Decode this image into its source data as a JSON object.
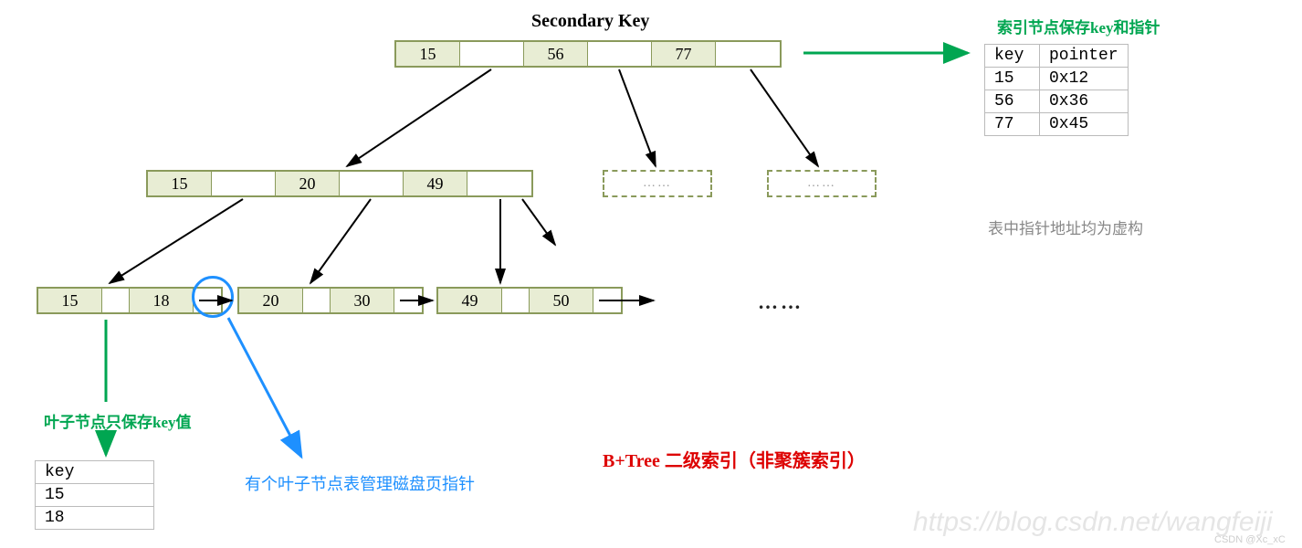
{
  "title": "Secondary Key",
  "green_label_top": "索引节点保存key和指针",
  "green_label_leaf": "叶子节点只保存key值",
  "blue_label": "有个叶子节点表管理磁盘页指针",
  "red_label": "B+Tree 二级索引（非聚簇索引）",
  "gray_label": "表中指针地址均为虚构",
  "watermark": "https://blog.csdn.net/wangfeiji",
  "attribution": "CSDN @Xc_xC",
  "root_node": {
    "c1": "15",
    "c2": "56",
    "c3": "77"
  },
  "child_node": {
    "c1": "15",
    "c2": "20",
    "c3": "49"
  },
  "leaf1": {
    "c1": "15",
    "c2": "18"
  },
  "leaf2": {
    "c1": "20",
    "c2": "30"
  },
  "leaf3": {
    "c1": "49",
    "c2": "50"
  },
  "ellipsis": "……",
  "pointer_table": {
    "header": {
      "c1": "key",
      "c2": "pointer"
    },
    "r1": {
      "c1": "15",
      "c2": "0x12"
    },
    "r2": {
      "c1": "56",
      "c2": "0x36"
    },
    "r3": {
      "c1": "77",
      "c2": "0x45"
    }
  },
  "leaf_table": {
    "header": {
      "c1": "key"
    },
    "r1": {
      "c1": "15"
    },
    "r2": {
      "c1": "18"
    }
  }
}
